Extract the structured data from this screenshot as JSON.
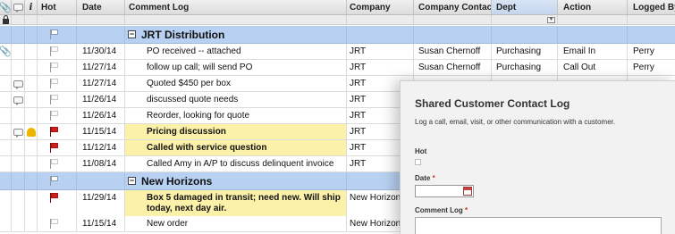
{
  "columns": {
    "hot": "Hot",
    "date": "Date",
    "comment_log": "Comment Log",
    "company": "Company",
    "company_contact": "Company Contact",
    "dept": "Dept",
    "action": "Action",
    "logged_by": "Logged By"
  },
  "groups": [
    {
      "label": "JRT Distribution"
    },
    {
      "label": "New Horizons"
    }
  ],
  "rows_jrt": [
    {
      "date": "11/30/14",
      "log": "PO received -- attached",
      "company": "JRT",
      "contact": "Susan Chernoff",
      "dept": "Purchasing",
      "action": "Email In",
      "logged": "Perry"
    },
    {
      "date": "11/27/14",
      "log": "follow up call; will send PO",
      "company": "JRT",
      "contact": "Susan Chernoff",
      "dept": "Purchasing",
      "action": "Call Out",
      "logged": "Perry"
    },
    {
      "date": "11/27/14",
      "log": "Quoted $450 per box",
      "company": "JRT",
      "contact": "",
      "dept": "",
      "action": "",
      "logged": ""
    },
    {
      "date": "11/26/14",
      "log": "discussed quote needs",
      "company": "JRT",
      "contact": "",
      "dept": "",
      "action": "",
      "logged": ""
    },
    {
      "date": "11/26/14",
      "log": "Reorder, looking for quote",
      "company": "JRT",
      "contact": "",
      "dept": "",
      "action": "",
      "logged": ""
    },
    {
      "date": "11/15/14",
      "log": "Pricing discussion",
      "company": "JRT",
      "contact": "",
      "dept": "",
      "action": "",
      "logged": ""
    },
    {
      "date": "11/12/14",
      "log": "Called with service question",
      "company": "JRT",
      "contact": "",
      "dept": "",
      "action": "",
      "logged": ""
    },
    {
      "date": "11/08/14",
      "log": "Called Amy in A/P to discuss delinquent invoice",
      "company": "JRT",
      "contact": "",
      "dept": "",
      "action": "",
      "logged": ""
    }
  ],
  "rows_nh": [
    {
      "date": "11/29/14",
      "log": "Box 5 damaged in transit; need new. Will ship today, next day air.",
      "company": "New Horizons"
    },
    {
      "date": "11/15/14",
      "log": "New order",
      "company": "New Horizons"
    }
  ],
  "form": {
    "title": "Shared Customer Contact Log",
    "description": "Log a call, email, visit, or other communication with a customer.",
    "hot_label": "Hot",
    "date_label": "Date",
    "comment_label": "Comment Log",
    "required_mark": "*"
  },
  "colors": {
    "group_band": "#b8d1f2",
    "highlight": "#fbf1a9",
    "flag_red": "#d11c1c"
  }
}
